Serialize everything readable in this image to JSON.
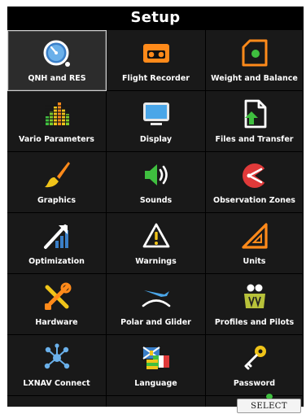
{
  "title": "Setup",
  "selected_index": 0,
  "tiles": [
    {
      "label": "QNH and RES",
      "icon": "gauge-icon"
    },
    {
      "label": "Flight Recorder",
      "icon": "cassette-icon"
    },
    {
      "label": "Weight and Balance",
      "icon": "weight-icon"
    },
    {
      "label": "Vario Parameters",
      "icon": "vario-bars-icon"
    },
    {
      "label": "Display",
      "icon": "monitor-icon"
    },
    {
      "label": "Files and Transfer",
      "icon": "file-upload-icon"
    },
    {
      "label": "Graphics",
      "icon": "paintbrush-icon"
    },
    {
      "label": "Sounds",
      "icon": "speaker-icon"
    },
    {
      "label": "Observation Zones",
      "icon": "observation-zone-icon"
    },
    {
      "label": "Optimization",
      "icon": "chart-arrow-icon"
    },
    {
      "label": "Warnings",
      "icon": "warning-icon"
    },
    {
      "label": "Units",
      "icon": "triangle-ruler-icon"
    },
    {
      "label": "Hardware",
      "icon": "tools-icon"
    },
    {
      "label": "Polar and Glider",
      "icon": "glider-polar-icon"
    },
    {
      "label": "Profiles and Pilots",
      "icon": "pilots-icon"
    },
    {
      "label": "LXNAV Connect",
      "icon": "network-icon"
    },
    {
      "label": "Language",
      "icon": "flags-icon"
    },
    {
      "label": "Password",
      "icon": "key-icon"
    }
  ],
  "select_label": "SELECT",
  "colors": {
    "accent_orange": "#ff8a1a",
    "accent_green": "#3fbf3f",
    "background": "#000000",
    "tile": "#191919"
  }
}
